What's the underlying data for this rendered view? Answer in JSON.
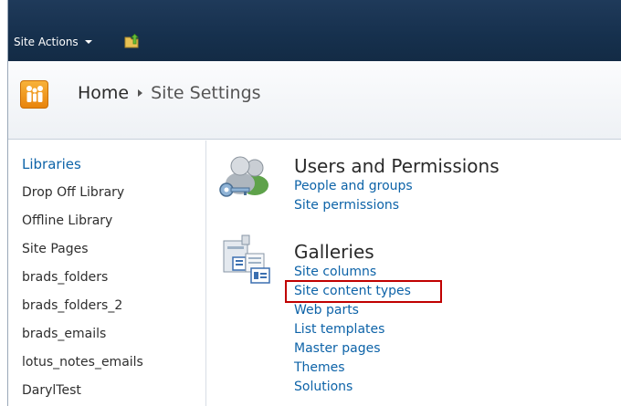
{
  "ribbon": {
    "site_actions_label": "Site Actions",
    "nav_icon": "folder-up-arrow-icon"
  },
  "title_band": {
    "logo_icon": "site-people-logo-icon",
    "breadcrumb": {
      "home": "Home",
      "current": "Site Settings"
    }
  },
  "leftnav": {
    "heading": "Libraries",
    "items": [
      "Drop Off Library",
      "Offline Library",
      "Site Pages",
      "brads_folders",
      "brads_folders_2",
      "brads_emails",
      "lotus_notes_emails",
      "DarylTest"
    ]
  },
  "main": {
    "users_and_permissions": {
      "icon": "users-key-icon",
      "title": "Users and Permissions",
      "links": [
        "People and groups",
        "Site permissions"
      ]
    },
    "galleries": {
      "icon": "galleries-icon",
      "title": "Galleries",
      "links": [
        "Site columns",
        "Site content types",
        "Web parts",
        "List templates",
        "Master pages",
        "Themes",
        "Solutions"
      ],
      "highlighted_link": "Site content types"
    }
  },
  "colors": {
    "ribbon": "#16304d",
    "link": "#0d63a8",
    "highlight": "#c00000",
    "logo": "#f0a020"
  }
}
